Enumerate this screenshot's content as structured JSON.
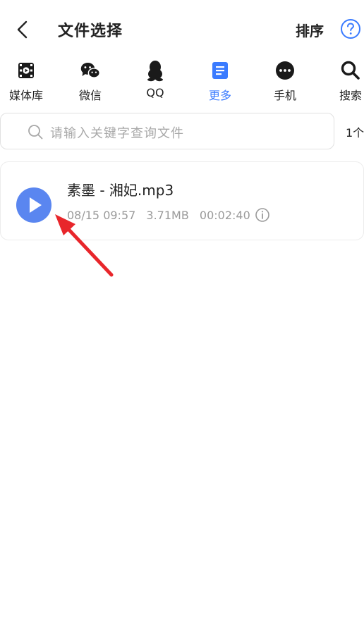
{
  "header": {
    "back_icon": "chevron-left-icon",
    "title": "文件选择",
    "sort_label": "排序",
    "help_icon": "question-circle-icon"
  },
  "tabs": [
    {
      "label": "媒体库",
      "icon": "film-icon",
      "active": false
    },
    {
      "label": "微信",
      "icon": "wechat-icon",
      "active": false
    },
    {
      "label": "QQ",
      "icon": "qq-penguin-icon",
      "active": false
    },
    {
      "label": "更多",
      "icon": "document-icon",
      "active": true
    },
    {
      "label": "手机",
      "icon": "more-dots-icon",
      "active": false
    },
    {
      "label": "搜索",
      "icon": "search-icon",
      "active": false
    }
  ],
  "search": {
    "placeholder": "请输入关键字查询文件",
    "count": "1个"
  },
  "files": [
    {
      "name": "素墨 - 湘妃.mp3",
      "date": "08/15 09:57",
      "size": "3.71MB",
      "duration": "00:02:40"
    }
  ],
  "colors": {
    "accent": "#3a7bff",
    "play": "#5a86f0",
    "arrow": "#e8262b"
  }
}
